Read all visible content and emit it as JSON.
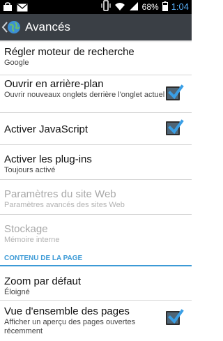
{
  "status_bar": {
    "battery": "68%",
    "time": "1:04",
    "icons": [
      "bag-icon",
      "mail-icon",
      "vibrate-icon",
      "wifi-icon",
      "signal-icon",
      "battery-icon"
    ]
  },
  "action_bar": {
    "title": "Avancés",
    "icon": "globe-icon"
  },
  "settings": {
    "search_engine": {
      "title": "Régler moteur de recherche",
      "summary": "Google"
    },
    "background_open": {
      "title": "Ouvrir en arrière-plan",
      "summary": "Ouvrir nouveaux onglets derrière l'onglet actuel",
      "checked": true
    },
    "javascript": {
      "title": "Activer JavaScript",
      "checked": true
    },
    "plugins": {
      "title": "Activer les plug-ins",
      "summary": "Toujours activé"
    },
    "site_settings": {
      "title": "Paramètres du site Web",
      "summary": "Paramètres avancés des sites Web",
      "enabled": false
    },
    "storage": {
      "title": "Stockage",
      "summary": "Mémoire interne",
      "enabled": false
    },
    "page_content_header": "CONTENU DE LA PAGE",
    "default_zoom": {
      "title": "Zoom par défaut",
      "summary": "Éloigné"
    },
    "overview": {
      "title": "Vue d'ensemble des pages",
      "summary": "Afficher un aperçu des pages ouvertes récemment",
      "checked": true
    }
  },
  "colors": {
    "accent": "#3c9ad6",
    "action_bar": "#3a3f45",
    "checkbox_fill": "#4f6576",
    "disabled_text": "#a8a8a8"
  }
}
